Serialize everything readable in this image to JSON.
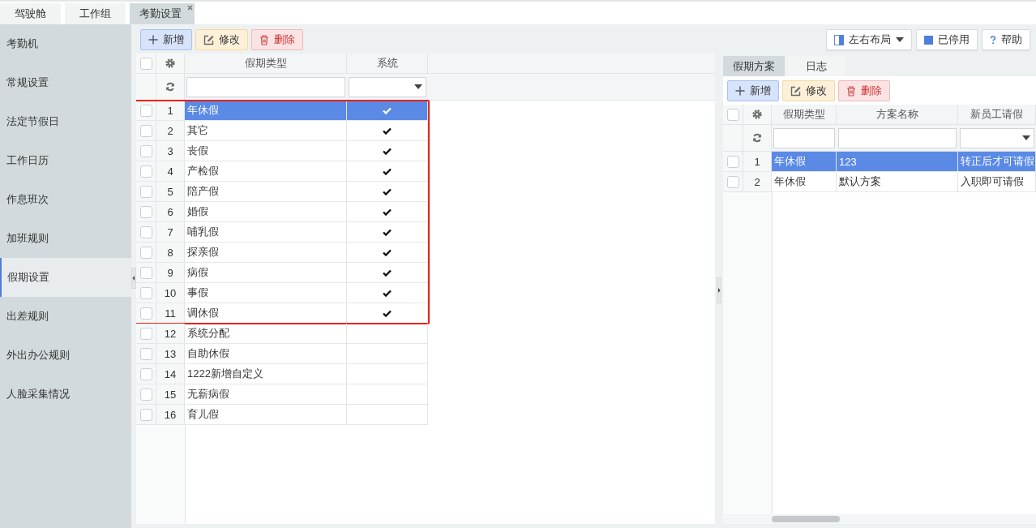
{
  "top_tabs": [
    {
      "label": "驾驶舱",
      "selected": false,
      "closable": false
    },
    {
      "label": "工作组",
      "selected": false,
      "closable": false
    },
    {
      "label": "考勤设置",
      "selected": true,
      "closable": true
    }
  ],
  "sidebar": {
    "items": [
      {
        "label": "考勤机",
        "selected": false
      },
      {
        "label": "常规设置",
        "selected": false
      },
      {
        "label": "法定节假日",
        "selected": false
      },
      {
        "label": "工作日历",
        "selected": false
      },
      {
        "label": "作息班次",
        "selected": false
      },
      {
        "label": "加班规则",
        "selected": false
      },
      {
        "label": "假期设置",
        "selected": true
      },
      {
        "label": "出差规则",
        "selected": false
      },
      {
        "label": "外出办公规则",
        "selected": false
      },
      {
        "label": "人脸采集情况",
        "selected": false
      }
    ]
  },
  "toolbar": {
    "buttons": [
      {
        "label": "新增",
        "kind": "add"
      },
      {
        "label": "修改",
        "kind": "edit"
      },
      {
        "label": "删除",
        "kind": "delete"
      }
    ]
  },
  "view_buttons": [
    {
      "label": "左右布局",
      "kind": "layout"
    },
    {
      "label": "已停用",
      "kind": "disabled"
    },
    {
      "label": "帮助",
      "kind": "help"
    }
  ],
  "left_grid": {
    "select_all_checked": false,
    "columns": [
      {
        "label": "假期类型",
        "kind": "text"
      },
      {
        "label": "系统",
        "kind": "check"
      }
    ],
    "row_groups": [
      {
        "highlighted": true,
        "rows": [
          {
            "number": "1",
            "cells": [
              "年休假",
              true
            ],
            "checked": false,
            "selected": true
          },
          {
            "number": "2",
            "cells": [
              "其它",
              true
            ],
            "checked": false,
            "selected": false
          },
          {
            "number": "3",
            "cells": [
              "丧假",
              true
            ],
            "checked": false,
            "selected": false
          },
          {
            "number": "4",
            "cells": [
              "产检假",
              true
            ],
            "checked": false,
            "selected": false
          },
          {
            "number": "5",
            "cells": [
              "陪产假",
              true
            ],
            "checked": false,
            "selected": false
          },
          {
            "number": "6",
            "cells": [
              "婚假",
              true
            ],
            "checked": false,
            "selected": false
          },
          {
            "number": "7",
            "cells": [
              "哺乳假",
              true
            ],
            "checked": false,
            "selected": false
          },
          {
            "number": "8",
            "cells": [
              "探亲假",
              true
            ],
            "checked": false,
            "selected": false
          },
          {
            "number": "9",
            "cells": [
              "病假",
              true
            ],
            "checked": false,
            "selected": false
          },
          {
            "number": "10",
            "cells": [
              "事假",
              true
            ],
            "checked": false,
            "selected": false
          },
          {
            "number": "11",
            "cells": [
              "调休假",
              true
            ],
            "checked": false,
            "selected": false
          }
        ]
      },
      {
        "highlighted": false,
        "rows": [
          {
            "number": "12",
            "cells": [
              "系统分配",
              false
            ],
            "checked": false,
            "selected": false
          },
          {
            "number": "13",
            "cells": [
              "自助休假",
              false
            ],
            "checked": false,
            "selected": false
          },
          {
            "number": "14",
            "cells": [
              "1222新增自定义",
              false
            ],
            "checked": false,
            "selected": false
          },
          {
            "number": "15",
            "cells": [
              "无薪病假",
              false
            ],
            "checked": false,
            "selected": false
          },
          {
            "number": "16",
            "cells": [
              "育儿假",
              false
            ],
            "checked": false,
            "selected": false
          }
        ]
      }
    ]
  },
  "right_panel": {
    "tabs": [
      {
        "label": "假期方案",
        "selected": true
      },
      {
        "label": "日志",
        "selected": false
      }
    ],
    "toolbar": {
      "buttons": [
        {
          "label": "新增",
          "kind": "add"
        },
        {
          "label": "修改",
          "kind": "edit"
        },
        {
          "label": "删除",
          "kind": "delete"
        }
      ]
    },
    "grid": {
      "select_all_checked": false,
      "columns": [
        {
          "label": "假期类型",
          "kind": "text"
        },
        {
          "label": "方案名称",
          "kind": "text"
        },
        {
          "label": "新员工请假",
          "kind": "select"
        }
      ],
      "rows": [
        {
          "number": "1",
          "cells": [
            "年休假",
            "123",
            "转正后才可请假"
          ],
          "checked": false,
          "selected": true
        },
        {
          "number": "2",
          "cells": [
            "年休假",
            "默认方案",
            "入职即可请假"
          ],
          "checked": false,
          "selected": false
        }
      ]
    }
  }
}
